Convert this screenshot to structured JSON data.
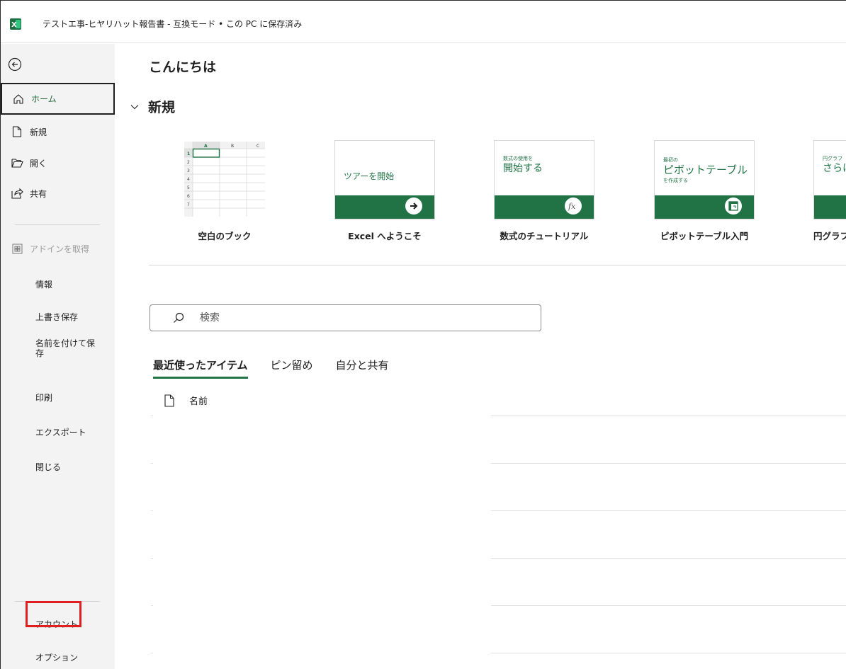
{
  "titlebar": {
    "title": "テストエ事-ヒヤリハット報告書  -  互換モード • この PC に保存済み",
    "app_icon": "excel-icon"
  },
  "sidebar": {
    "back_icon": "back-arrow-icon",
    "home": {
      "label": "ホーム",
      "icon": "home-icon"
    },
    "new": {
      "label": "新規",
      "icon": "new-document-icon"
    },
    "open": {
      "label": "開く",
      "icon": "folder-open-icon"
    },
    "share": {
      "label": "共有",
      "icon": "share-icon"
    },
    "addins": {
      "label": "アドインを取得",
      "icon": "grid-addins-icon"
    },
    "info": "情報",
    "save": "上書き保存",
    "save_as": "名前を付けて保\n存",
    "print": "印刷",
    "export": "エクスポート",
    "close": "閉じる",
    "account": "アカウント",
    "options": "オプション"
  },
  "main": {
    "greeting": "こんにちは",
    "new_section": "新規",
    "templates": [
      {
        "label": "空白のブック"
      },
      {
        "label": "Excel へようこそ",
        "thumb_text": "ツアーを開始"
      },
      {
        "label": "数式のチュートリアル",
        "thumb_small": "数式の使用を",
        "thumb_big": "開始する"
      },
      {
        "label": "ピボットテーブル入門",
        "thumb_small": "最初の",
        "thumb_big": "ピボットテーブル",
        "thumb_small2": "を作成する"
      },
      {
        "label": "円グラフのチ",
        "thumb_small": "円グラフ",
        "thumb_big": "さらに"
      }
    ],
    "grid_thumb": {
      "columns": [
        "A",
        "B",
        "C"
      ],
      "rows": [
        "1",
        "2",
        "3",
        "4",
        "5",
        "6",
        "7"
      ]
    },
    "search": {
      "placeholder": "検索"
    },
    "tabs": [
      "最近使ったアイテム",
      "ピン留め",
      "自分と共有"
    ],
    "list_header": "名前"
  },
  "colors": {
    "accent_green": "#217346",
    "highlight_red": "#e02020"
  }
}
